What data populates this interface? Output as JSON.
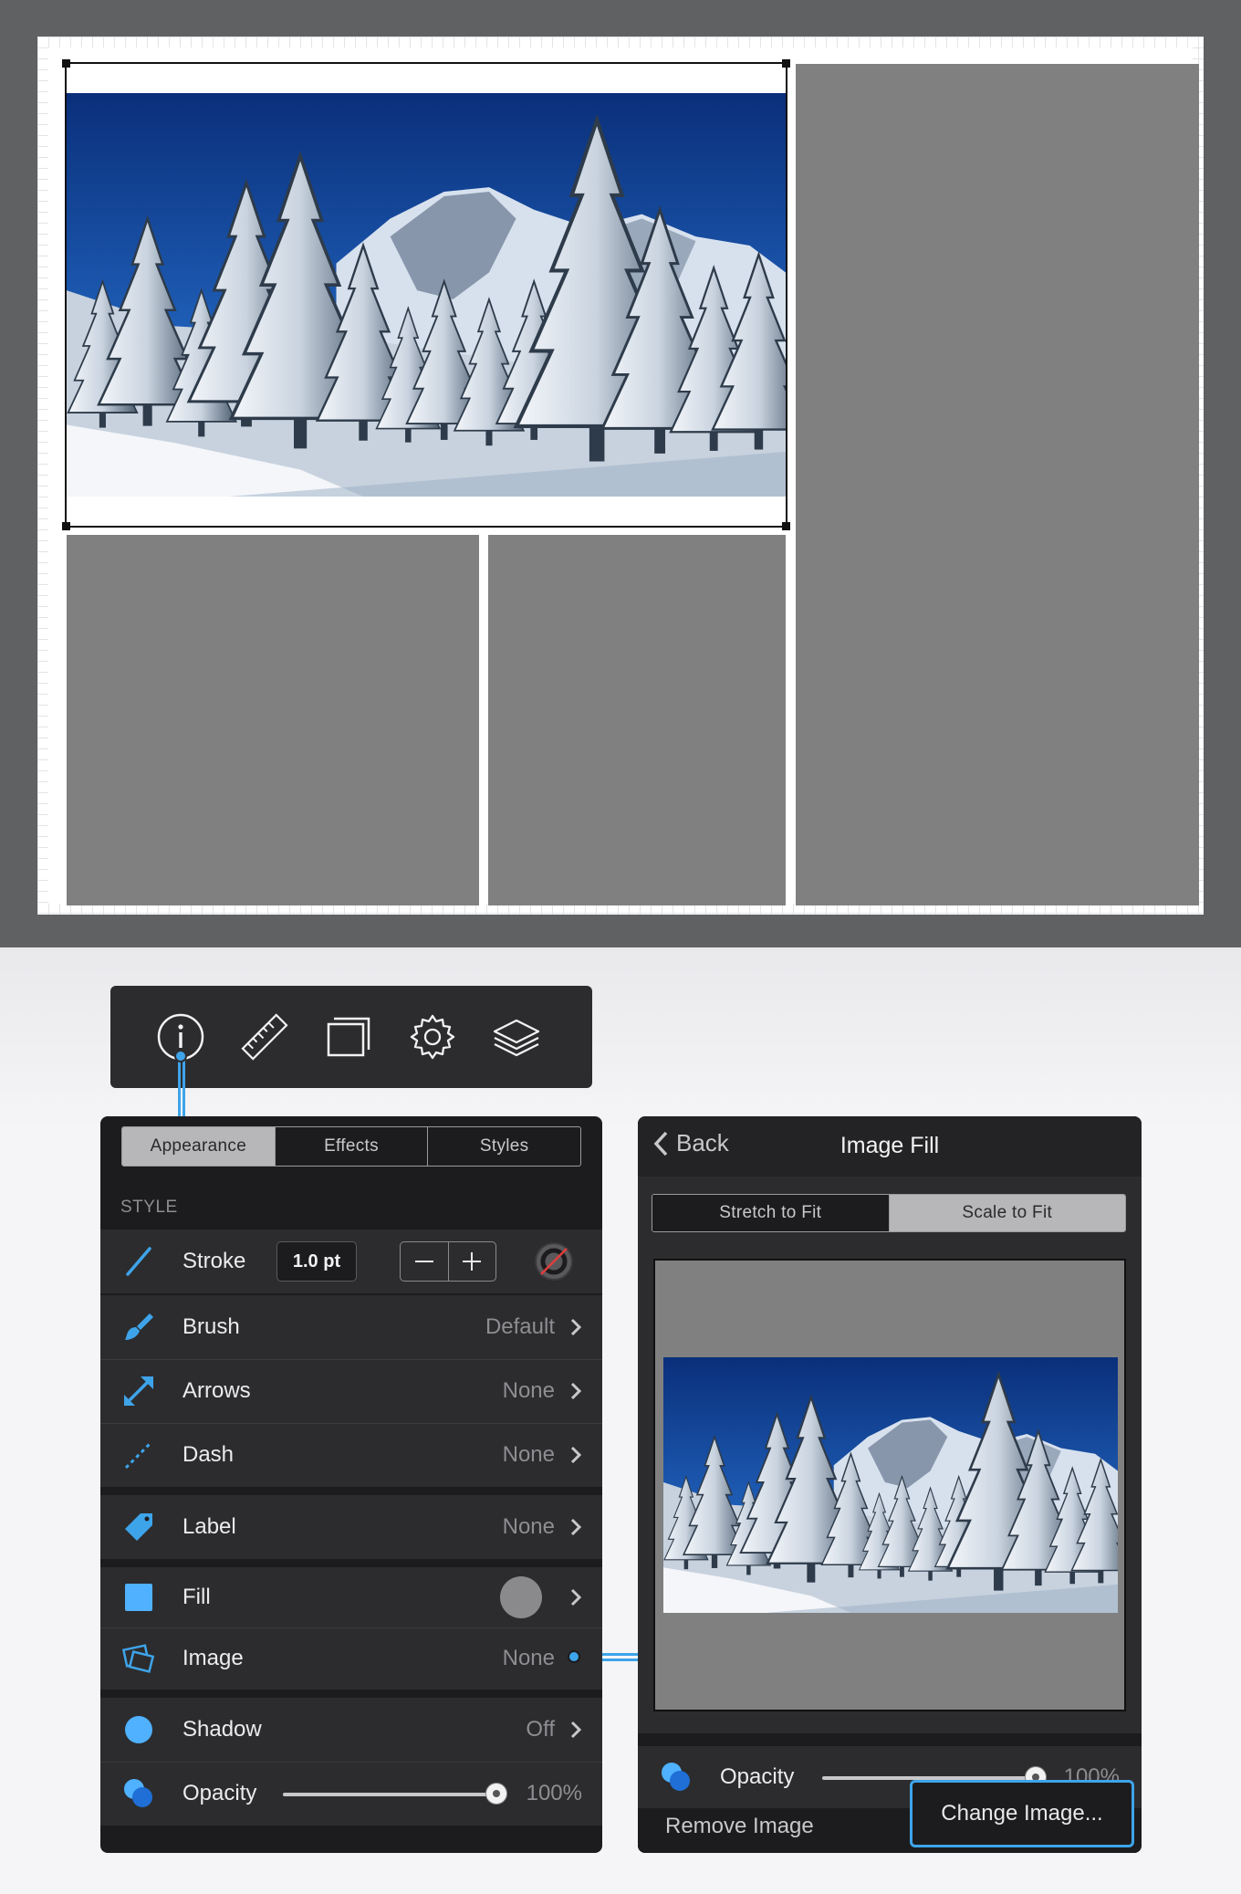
{
  "toolbar": {
    "tools": [
      {
        "name": "info-icon"
      },
      {
        "name": "ruler-icon"
      },
      {
        "name": "canvas-icon"
      },
      {
        "name": "gear-icon"
      },
      {
        "name": "layers-icon"
      }
    ]
  },
  "inspector": {
    "tabs": [
      "Appearance",
      "Effects",
      "Styles"
    ],
    "active_tab": "Appearance",
    "section": "STYLE",
    "stroke": {
      "label": "Stroke",
      "width": "1.0 pt",
      "minus": "−",
      "plus": "+"
    },
    "brush": {
      "label": "Brush",
      "value": "Default"
    },
    "arrows": {
      "label": "Arrows",
      "value": "None"
    },
    "dash": {
      "label": "Dash",
      "value": "None"
    },
    "label_row": {
      "label": "Label",
      "value": "None"
    },
    "fill": {
      "label": "Fill",
      "swatch_color": "#8a8a8c"
    },
    "image": {
      "label": "Image",
      "value": "None"
    },
    "shadow": {
      "label": "Shadow",
      "value": "Off"
    },
    "opacity": {
      "label": "Opacity",
      "value": "100%",
      "level": 1.0
    }
  },
  "image_fill": {
    "back_label": "Back",
    "title": "Image Fill",
    "modes": [
      "Stretch to Fit",
      "Scale to Fit"
    ],
    "active_mode": "Scale to Fit",
    "opacity": {
      "label": "Opacity",
      "value": "100%",
      "level": 1.0
    },
    "remove_label": "Remove Image",
    "change_label": "Change Image..."
  },
  "colors": {
    "accent": "#3ea4ea",
    "panel_bg": "#1c1c1e",
    "row_bg": "#2c2c2e",
    "placeholder_gray": "#808080"
  }
}
